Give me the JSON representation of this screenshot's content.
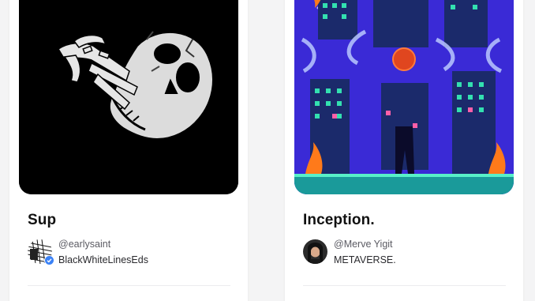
{
  "cards": [
    {
      "title": "Sup",
      "creator_handle": "@earlysaint",
      "collection": "BlackWhiteLinesEds",
      "verified": true,
      "artwork_icon": "skull-hand-artwork"
    },
    {
      "title": "Inception.",
      "creator_handle": "@Merve Yigit",
      "collection": "METAVERSE.",
      "verified": false,
      "artwork_icon": "city-night-artwork"
    }
  ],
  "colors": {
    "background": "#f4f4f5",
    "card": "#ffffff",
    "verified_badge": "#3b82f6",
    "city_sky": "#3a2ad6"
  }
}
